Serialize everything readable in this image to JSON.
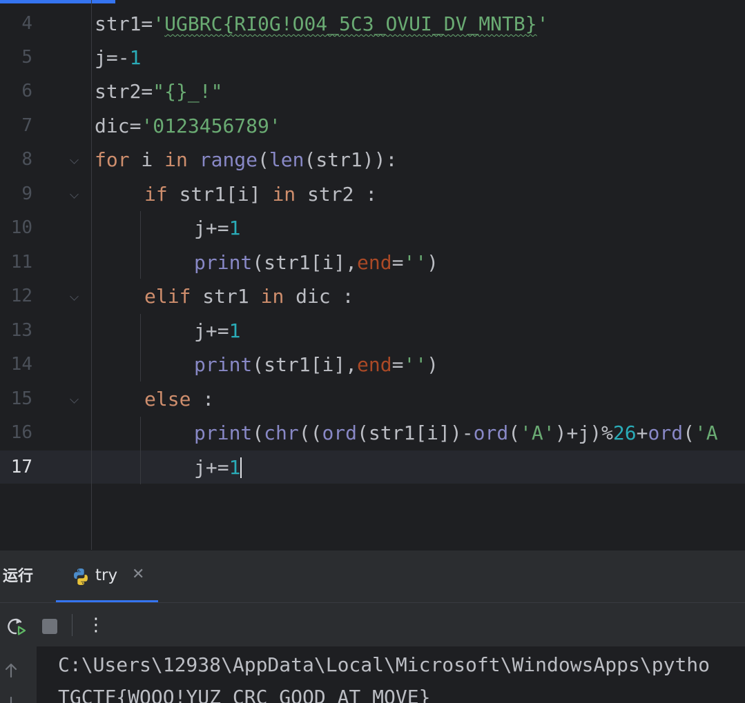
{
  "editor": {
    "lines": [
      {
        "num": "4"
      },
      {
        "num": "5"
      },
      {
        "num": "6"
      },
      {
        "num": "7"
      },
      {
        "num": "8"
      },
      {
        "num": "9"
      },
      {
        "num": "10"
      },
      {
        "num": "11"
      },
      {
        "num": "12"
      },
      {
        "num": "13"
      },
      {
        "num": "14"
      },
      {
        "num": "15"
      },
      {
        "num": "16"
      },
      {
        "num": "17"
      }
    ],
    "tokens": {
      "l4_a": "str1=",
      "l4_q1": "'",
      "l4_s": "UGBRC{RI0G!O04_5C3_OVUI_DV_MNTB}",
      "l4_q2": "'",
      "l5_a": "j=-",
      "l5_n": "1",
      "l6_a": "str2=",
      "l6_s": "\"{}_!\"",
      "l7_a": "dic=",
      "l7_s": "'0123456789'",
      "l8_for": "for",
      "l8_i": " i ",
      "l8_in": "in",
      "l8_sp": " ",
      "l8_range": "range",
      "l8_p1": "(",
      "l8_len": "len",
      "l8_rest": "(str1)):",
      "l9_if": "if",
      "l9_mid": " str1[i] ",
      "l9_in": "in",
      "l9_rest": " str2 :",
      "l10_a": "j+=",
      "l10_n": "1",
      "l11_print": "print",
      "l11_a": "(str1[i],",
      "l11_end": "end",
      "l11_eq": "=",
      "l11_s": "''",
      "l11_close": ")",
      "l12_elif": "elif",
      "l12_mid": " str1 ",
      "l12_in": "in",
      "l12_rest": " dic :",
      "l13_a": "j+=",
      "l13_n": "1",
      "l14_print": "print",
      "l14_a": "(str1[i],",
      "l14_end": "end",
      "l14_eq": "=",
      "l14_s": "''",
      "l14_close": ")",
      "l15_else": "else",
      "l15_rest": " :",
      "l16_print": "print",
      "l16_p": "(",
      "l16_chr": "chr",
      "l16_p2": "((",
      "l16_ord1": "ord",
      "l16_b": "(str1[i])-",
      "l16_ord2": "ord",
      "l16_p3": "(",
      "l16_sA": "'A'",
      "l16_c": ")+j)%",
      "l16_n": "26",
      "l16_plus": "+",
      "l16_ord3": "ord",
      "l16_p4": "(",
      "l16_sA2": "'A",
      "l17_a": "j+=",
      "l17_n": "1"
    }
  },
  "run_panel": {
    "title": "运行",
    "tab_label": "try",
    "tab_close": "✕",
    "more_label": "⋮",
    "console_lines": [
      "C:\\Users\\12938\\AppData\\Local\\Microsoft\\WindowsApps\\pytho",
      "TGCTF{WOOO!YUZ_CRC_GOOD_AT_MOVE}"
    ]
  },
  "icons": {
    "rerun": "rerun-icon",
    "stop": "stop-icon",
    "python": "python-icon",
    "scroll_up": "arrow-up-icon",
    "scroll_down": "arrow-down-icon"
  },
  "colors": {
    "keyword": "#cf8e6d",
    "number": "#2aacb8",
    "string": "#6aab73",
    "builtin": "#8888c6",
    "param": "#aa4926",
    "accent": "#3574f0"
  }
}
